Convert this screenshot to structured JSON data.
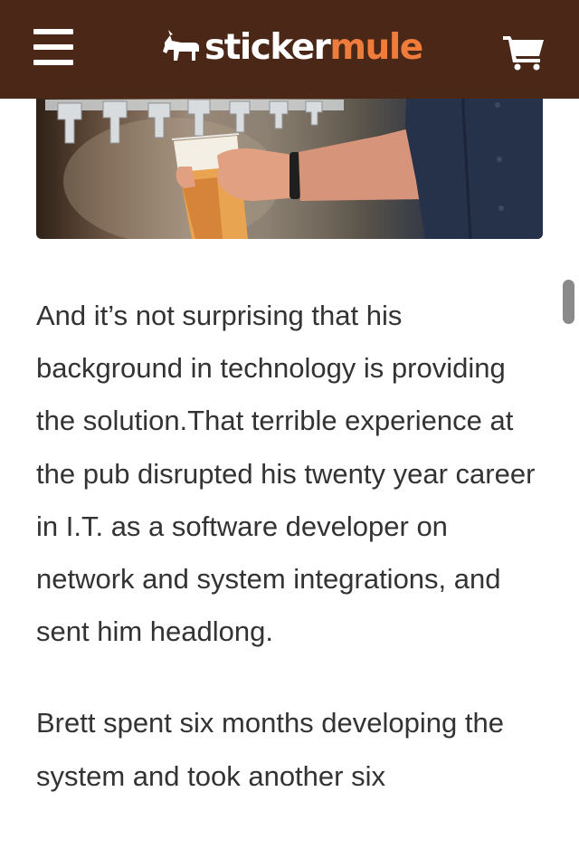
{
  "header": {
    "menu_icon": "hamburger-menu-icon",
    "logo": {
      "icon": "mule-icon",
      "word_sticker": "sticker",
      "word_mule": "mule",
      "color_sticker": "#ffffff",
      "color_mule": "#f07c3c"
    },
    "cart_icon": "shopping-cart-icon",
    "background_color": "#4a2717"
  },
  "hero_image": {
    "subject": "beer-tap-pouring-photo"
  },
  "article": {
    "paragraphs": [
      "And it’s not surprising that his background in technology is providing the solution.That terrible experience at the pub disrupted his twenty year career in I.T. as a software developer on network and system integrations, and sent him headlong.",
      "Brett spent six months developing the system and took another six"
    ],
    "text_color": "#333333"
  }
}
